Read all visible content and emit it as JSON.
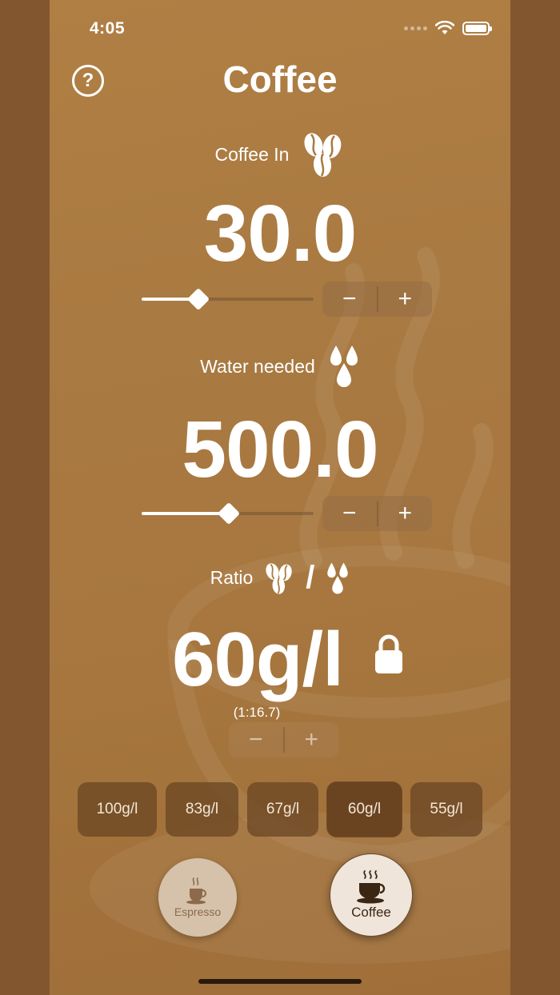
{
  "status": {
    "time": "4:05"
  },
  "header": {
    "title": "Coffee",
    "help_symbol": "?"
  },
  "coffee_in": {
    "label": "Coffee In",
    "value": "30.0",
    "icon": "coffee-beans-icon",
    "slider_fraction": 0.33
  },
  "water": {
    "label": "Water needed",
    "value": "500.0",
    "icon": "water-drops-icon",
    "slider_fraction": 0.5
  },
  "ratio": {
    "label": "Ratio",
    "separator": "/",
    "value": "60g/l",
    "sub": "(1:16.7)",
    "lock_icon": "lock-icon"
  },
  "stepper": {
    "minus": "−",
    "plus": "+"
  },
  "presets": [
    {
      "label": "100g/l",
      "active": false
    },
    {
      "label": "83g/l",
      "active": false
    },
    {
      "label": "67g/l",
      "active": false
    },
    {
      "label": "60g/l",
      "active": true
    },
    {
      "label": "55g/l",
      "active": false
    }
  ],
  "modes": {
    "espresso": "Espresso",
    "coffee": "Coffee",
    "selected": "coffee"
  },
  "colors": {
    "background": "#a97a41",
    "frame": "#82562f",
    "preset": "#6e4924",
    "preset_active": "#6a4421"
  }
}
